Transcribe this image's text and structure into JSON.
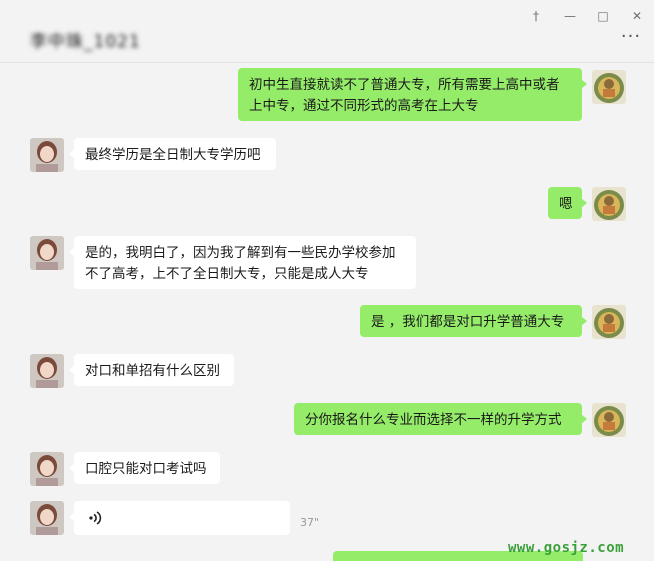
{
  "window": {
    "title": "李中珠_1021",
    "controls": {
      "pin": "†",
      "minimize": "—",
      "maximize": "□",
      "close": "✕"
    },
    "more_label": "···"
  },
  "messages": [
    {
      "from": "me",
      "lines": [
        "初中生直接就读不了普通大专，所有需要上高中或者",
        "上中专，通过不同形式的高考在上大专"
      ]
    },
    {
      "from": "other",
      "lines": [
        "最终学历是全日制大专学历吧"
      ]
    },
    {
      "from": "me",
      "lines": [
        "嗯"
      ]
    },
    {
      "from": "other",
      "lines": [
        "是的，我明白了，因为我了解到有一些民办学校参加",
        "不了高考，上不了全日制大专，只能是成人大专"
      ]
    },
    {
      "from": "me",
      "lines": [
        "是 ，我们都是对口升学普通大专"
      ]
    },
    {
      "from": "other",
      "lines": [
        "对口和单招有什么区别"
      ]
    },
    {
      "from": "me",
      "lines": [
        "分你报名什么专业而选择不一样的升学方式"
      ]
    },
    {
      "from": "other",
      "lines": [
        "口腔只能对口考试吗"
      ]
    },
    {
      "from": "other",
      "type": "voice",
      "icon": "voice-wave-icon",
      "duration": "37\""
    }
  ],
  "watermark": "www.gosjz.com",
  "colors": {
    "my_bubble": "#95ec69",
    "other_bubble": "#ffffff",
    "background": "#f3f3f3"
  }
}
